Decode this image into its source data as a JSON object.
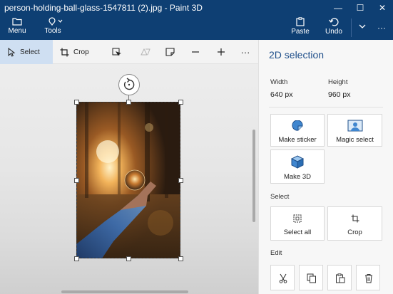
{
  "window": {
    "title": "person-holding-ball-glass-1547811 (2).jpg - Paint 3D",
    "minimize_glyph": "—",
    "maximize_glyph": "☐",
    "close_glyph": "✕"
  },
  "ribbon": {
    "menu": {
      "label": "Menu",
      "icon": "folder-icon"
    },
    "tools": {
      "label": "Tools",
      "icon": "pin-icon"
    },
    "paste": {
      "label": "Paste",
      "icon": "paste-icon"
    },
    "undo": {
      "label": "Undo",
      "icon": "undo-icon"
    },
    "dropdown": {
      "icon": "chevron-down-icon"
    },
    "more": {
      "label": "···",
      "icon": "more-icon"
    }
  },
  "toolbar": {
    "select": {
      "label": "Select",
      "active": true,
      "icon": "select-cursor-icon"
    },
    "crop": {
      "label": "Crop",
      "icon": "crop-icon"
    },
    "icons": [
      "magic-select-icon",
      "flip-icon",
      "sticker-shape-icon",
      "zoom-out-icon",
      "zoom-in-icon",
      "more-icon"
    ],
    "more": "···"
  },
  "panel": {
    "title": "2D selection",
    "width_label": "Width",
    "width_value": "640 px",
    "height_label": "Height",
    "height_value": "960 px",
    "make_sticker": "Make sticker",
    "magic_select": "Magic select",
    "make_3d": "Make 3D",
    "select_section": "Select",
    "select_all": "Select all",
    "crop": "Crop",
    "edit_section": "Edit",
    "edit_icons": [
      "cut-icon",
      "copy-icon",
      "paste-icon",
      "delete-icon"
    ]
  },
  "colors": {
    "titlebar": "#0e3f73",
    "accent": "#1f4f8a",
    "select_highlight": "#cfdff2"
  }
}
